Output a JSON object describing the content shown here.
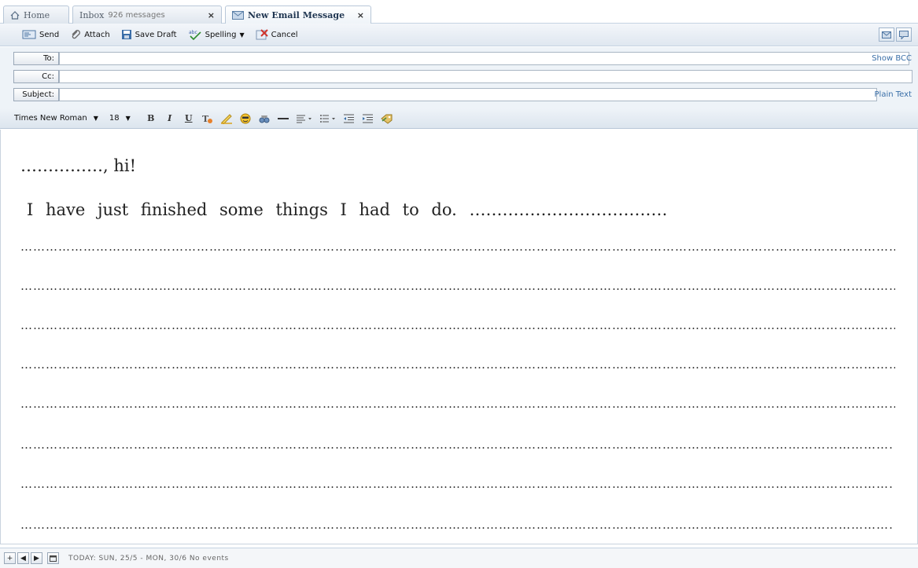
{
  "tabs": [
    {
      "label": "Home",
      "icon": "home-icon"
    },
    {
      "label": "Inbox",
      "sub": "926 messages",
      "close": "×"
    },
    {
      "label": "New Email Message",
      "icon": "envelope-icon",
      "close": "×"
    }
  ],
  "toolbar": {
    "send": "Send",
    "attach": "Attach",
    "save_draft": "Save Draft",
    "spelling": "Spelling",
    "cancel": "Cancel"
  },
  "fields": {
    "to_label": "To:",
    "to_value": "",
    "cc_label": "Cc:",
    "cc_value": "",
    "subject_label": "Subject:",
    "subject_value": "",
    "show_bcc": "Show BCC",
    "plain_text": "Plain Text"
  },
  "format": {
    "font": "Times New Roman",
    "size": "18",
    "bold": "B",
    "italic": "I",
    "underline": "U"
  },
  "body": {
    "greeting": "……………, hi!",
    "line2": "I have just finished some things I had to do. ………………………………"
  },
  "status": {
    "text": "TODAY: SUN, 25/5 - MON, 30/6 No events"
  },
  "colors": {
    "accent": "#3a6fa8",
    "toolbar_bg": "#dfe7f0",
    "tab_border": "#b8c7d8"
  }
}
